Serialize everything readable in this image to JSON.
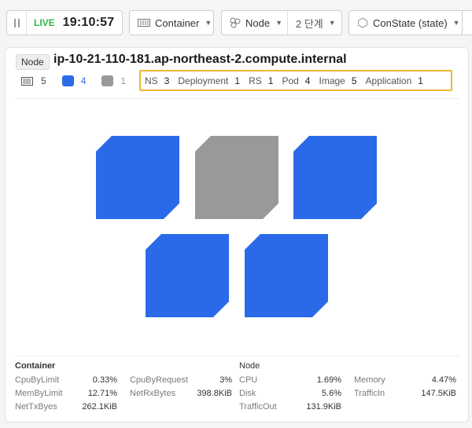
{
  "toolbar": {
    "live_label": "LIVE",
    "time": "19:10:57",
    "container_label": "Container",
    "node_label": "Node",
    "level_label": "2 단계",
    "state_label": "ConState (state)"
  },
  "node": {
    "badge": "Node",
    "name": "ip-10-21-110-181.ap-northeast-2.compute.internal"
  },
  "counts": {
    "containers": "5",
    "active": "4",
    "inactive": "1"
  },
  "resources": [
    {
      "label": "NS",
      "value": "3"
    },
    {
      "label": "Deployment",
      "value": "1"
    },
    {
      "label": "RS",
      "value": "1"
    },
    {
      "label": "Pod",
      "value": "4"
    },
    {
      "label": "Image",
      "value": "5"
    },
    {
      "label": "Application",
      "value": "1"
    }
  ],
  "cubes": [
    {
      "state": "active",
      "color": "#2a6ae9"
    },
    {
      "state": "inactive",
      "color": "#999999"
    },
    {
      "state": "active",
      "color": "#2a6ae9"
    },
    {
      "state": "active",
      "color": "#2a6ae9"
    },
    {
      "state": "active",
      "color": "#2a6ae9"
    }
  ],
  "container_stats": {
    "title": "Container",
    "items": [
      {
        "label": "CpuByLimit",
        "value": "0.33%"
      },
      {
        "label": "CpuByRequest",
        "value": "3%"
      },
      {
        "label": "MemByLimit",
        "value": "12.71%"
      },
      {
        "label": "NetRxBytes",
        "value": "398.8KiB"
      },
      {
        "label": "NetTxByes",
        "value": "262.1KiB"
      }
    ]
  },
  "node_stats": {
    "title": "Node",
    "items": [
      {
        "label": "CPU",
        "value": "1.69%"
      },
      {
        "label": "Memory",
        "value": "4.47%"
      },
      {
        "label": "Disk",
        "value": "5.6%"
      },
      {
        "label": "TrafficIn",
        "value": "147.5KiB"
      },
      {
        "label": "TrafficOut",
        "value": "131.9KiB"
      }
    ]
  },
  "colors": {
    "accent": "#2a6ae9",
    "inactive": "#999999",
    "live": "#2fb84a",
    "highlight": "#f0b830"
  }
}
